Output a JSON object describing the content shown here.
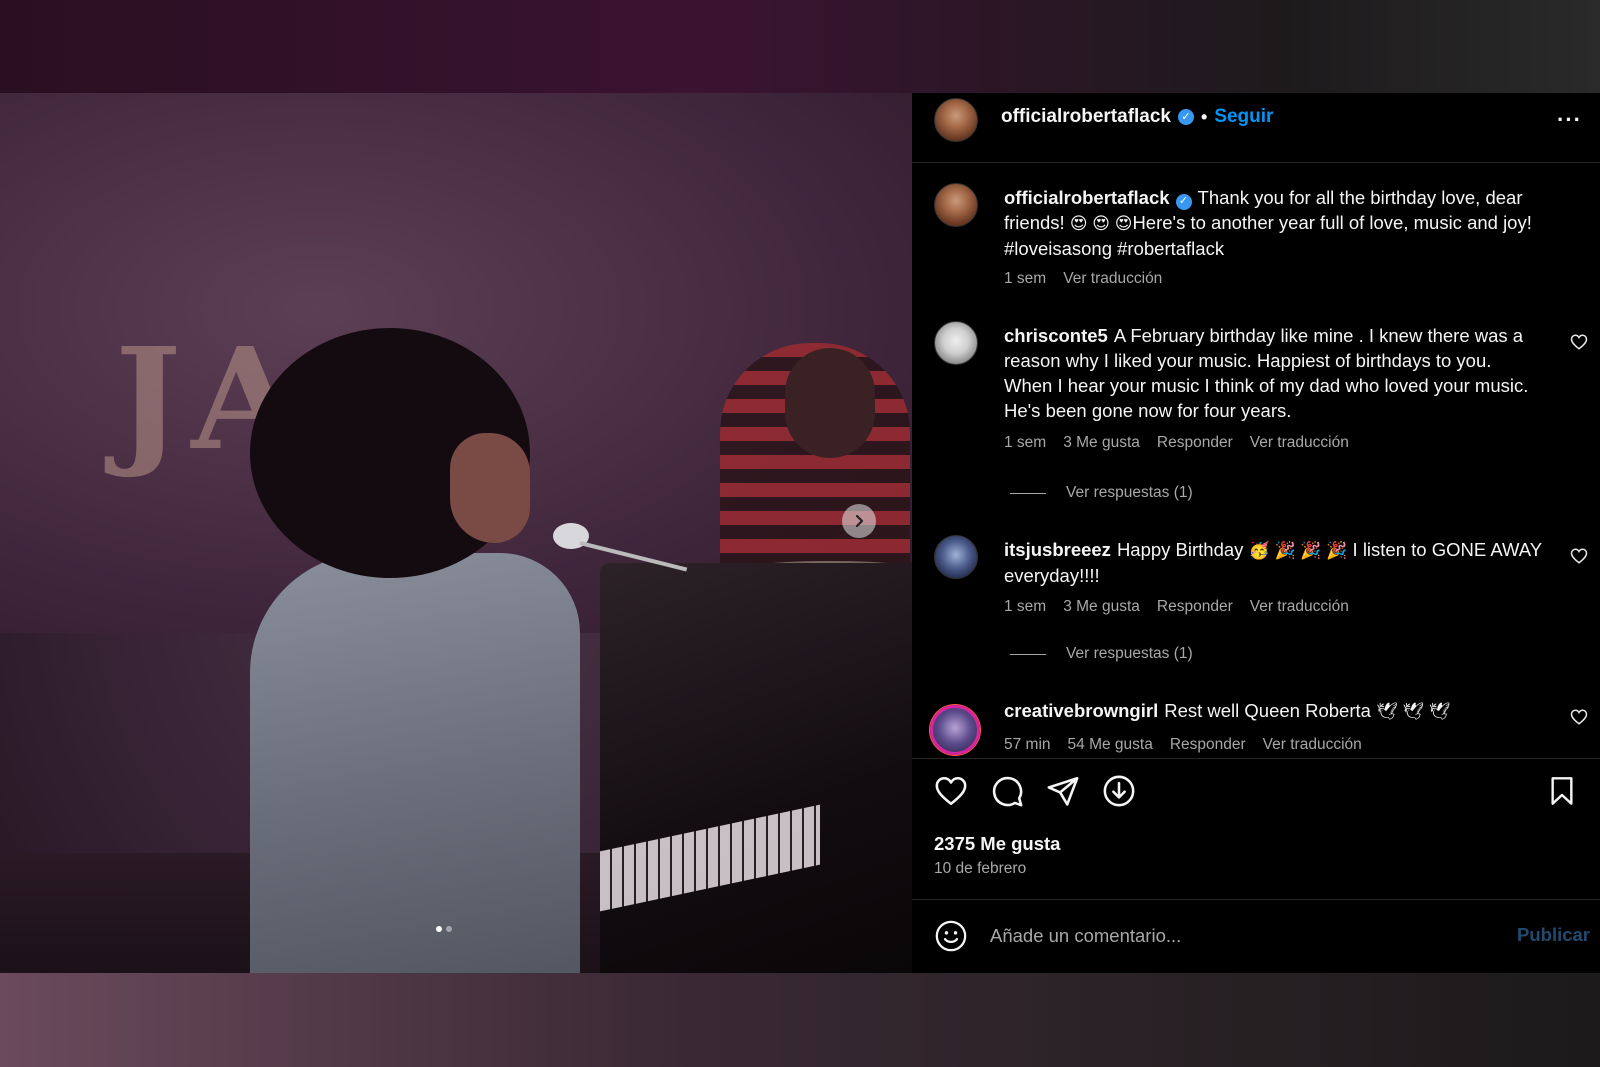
{
  "post": {
    "username": "officialrobertaflack",
    "separator": "•",
    "follow_label": "Seguir",
    "more_label": "···",
    "verified_mark": "✓",
    "caption": {
      "username": "officialrobertaflack",
      "text_part1": "Thank you for all the birthday love, dear friends!",
      "emojis1": "😍 😍 😍",
      "text_part2": "Here's to another year full of love, music and joy! #loveisasong #robertaflack",
      "time": "1 sem",
      "translate": "Ver traducción"
    },
    "comments": [
      {
        "username": "chrisconte5",
        "text": "A February birthday like mine . I knew there was a reason why I liked your music. Happiest of birthdays to you. When I hear your music I think of my dad who loved your music. He's been gone now for four years.",
        "time": "1 sem",
        "likes": "3 Me gusta",
        "reply": "Responder",
        "translate": "Ver traducción",
        "replies": "Ver respuestas (1)"
      },
      {
        "username": "itsjusbreeez",
        "text_part1": "Happy Birthday",
        "emojis": "🥳 🎉 🎉 🎉",
        "text_part2": "I listen to GONE AWAY everyday!!!!",
        "time": "1 sem",
        "likes": "3 Me gusta",
        "reply": "Responder",
        "translate": "Ver traducción",
        "replies": "Ver respuestas (1)"
      },
      {
        "username": "creativebrowngirl",
        "text_part1": "Rest well Queen Roberta",
        "emojis": "🕊 🕊 🕊",
        "time": "57 min",
        "likes": "54 Me gusta",
        "reply": "Responder",
        "translate": "Ver traducción"
      }
    ],
    "like_count": "2375 Me gusta",
    "date": "10 de febrero",
    "comment_placeholder": "Añade un comentario...",
    "publish_label": "Publicar",
    "icons": [
      "heart-icon",
      "comment-icon",
      "share-icon",
      "download-icon",
      "bookmark-icon",
      "emoji-icon",
      "chevron-right-icon"
    ],
    "colors": {
      "accent": "#0095f6",
      "verified": "#3897f0",
      "muted": "#a8a8a8",
      "publish_disabled": "#224a6f",
      "panel_bg": "#000000"
    },
    "carousel": {
      "slides": 2,
      "active": 1
    },
    "photo_sign_text": "JA"
  }
}
